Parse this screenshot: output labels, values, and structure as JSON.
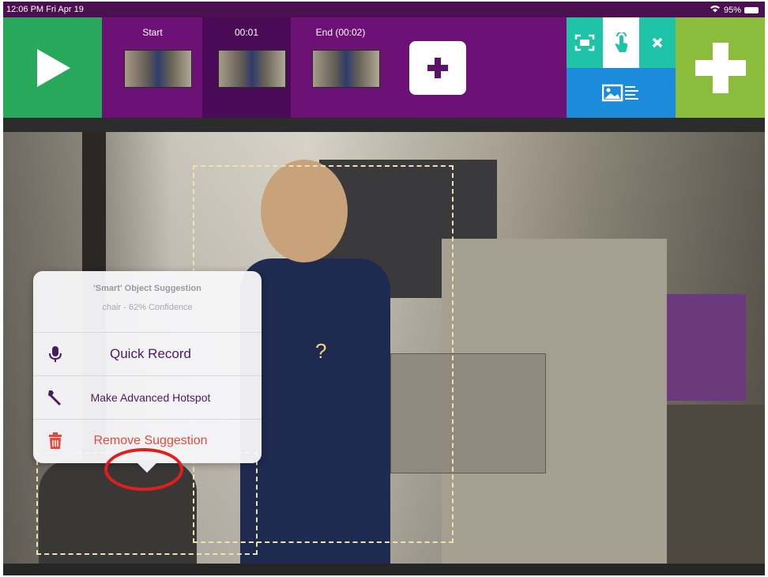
{
  "status": {
    "time": "12:06 PM  Fri Apr 19",
    "battery": "95%"
  },
  "timeline": {
    "frames": [
      {
        "label": "Start"
      },
      {
        "label": "00:01",
        "selected": true
      },
      {
        "label": "End (00:02)"
      }
    ]
  },
  "colors": {
    "play": "#27a85a",
    "toolbar": "#6e1177",
    "tool_teal": "#1fc4a8",
    "tool_blue": "#1c8bd9",
    "add_green": "#8cbc3c",
    "remove_red": "#e8483c"
  },
  "icons": {
    "play": "play-icon",
    "add_frame": "plus-icon",
    "select_region": "select-region-icon",
    "touch": "touch-icon",
    "close": "close-icon",
    "image_text": "image-text-icon",
    "add_big": "plus-icon",
    "mic": "microphone-icon",
    "wrench": "wrench-icon",
    "trash": "trash-icon"
  },
  "video": {
    "hotspot_marker": "?"
  },
  "popover": {
    "title": "'Smart' Object Suggestion",
    "subtitle": "chair - 62% Confidence",
    "actions": [
      {
        "label": "Quick Record"
      },
      {
        "label": "Make Advanced Hotspot"
      },
      {
        "label": "Remove Suggestion"
      }
    ]
  }
}
